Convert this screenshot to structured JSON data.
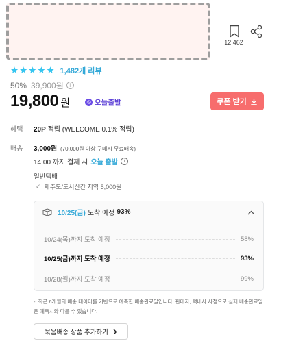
{
  "actions": {
    "bookmark_count": "12,462"
  },
  "rating": {
    "stars": 5,
    "review_count": "1,482개 리뷰"
  },
  "price": {
    "discount_rate": "50%",
    "original": "39,900원",
    "info_icon": "i",
    "current": "19,800",
    "currency": "원",
    "badge": "오늘출발",
    "badge_icon": "clock-icon"
  },
  "coupon": {
    "label": "쿠폰 받기"
  },
  "benefit": {
    "label": "혜택",
    "points": "20P",
    "desc": " 적립 (WELCOME 0.1% 적립)"
  },
  "shipping": {
    "label": "배송",
    "fee": "3,000원",
    "condition": "(70,000원 이상 구매시 무료배송)",
    "deadline_prefix": "14:00 까지 결제 시",
    "deadline_highlight": "오늘 출발",
    "type": "일반택배",
    "jeju": "제주도/도서산간 지역 5,000원"
  },
  "eta": {
    "summary_date": "10/25(금)",
    "summary_mid": "도착 예정",
    "summary_pct": "93%",
    "rows": [
      {
        "label": "10/24(목)까지 도착 예정",
        "value": "58%"
      },
      {
        "label": "10/25(금)까지 도착 예정",
        "value": "93%"
      },
      {
        "label": "10/28(월)까지 도착 예정",
        "value": "99%"
      }
    ]
  },
  "notice": {
    "text": "최근 6개월의 배송 데이터를 기반으로 예측한 배송완료일입니다. 판매자, 택배사 사정으로 실제 배송완료일은 예측치와 다를 수 있습니다."
  },
  "bundle": {
    "label": "묶음배송 상품 추가하기"
  },
  "colors": {
    "accent": "#35c5f0",
    "coupon": "#f76d6d",
    "badge": "#6b4ce6"
  }
}
